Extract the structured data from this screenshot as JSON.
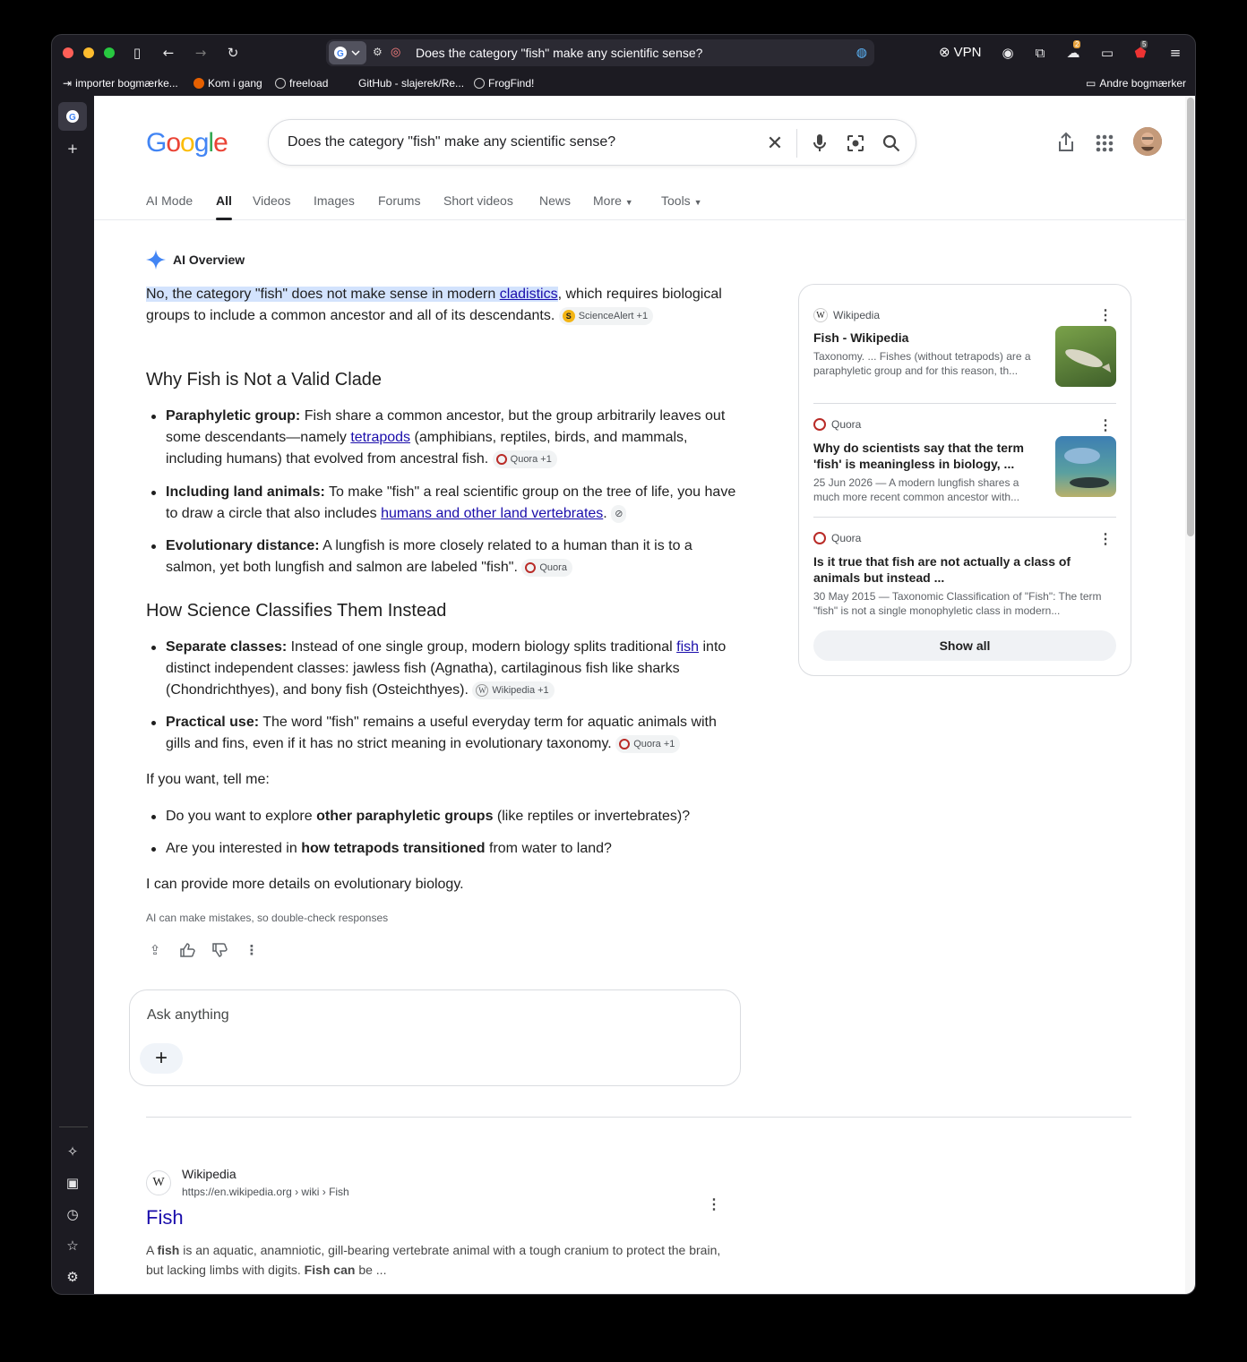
{
  "browser": {
    "url_text": "Does the category \"fish\" make any scientific sense?",
    "vpn_label": "VPN",
    "badge_counts": [
      "2",
      "5"
    ],
    "bookmarks": [
      {
        "label": "importer bogmærke..."
      },
      {
        "label": "Kom i gang"
      },
      {
        "label": "freeload"
      },
      {
        "label": "GitHub - slajerek/Re..."
      },
      {
        "label": "FrogFind!"
      }
    ],
    "other_bookmarks": "Andre bogmærker"
  },
  "google": {
    "logo": "Google",
    "query": "Does the category \"fish\" make any scientific sense?",
    "tabs": [
      "AI Mode",
      "All",
      "Videos",
      "Images",
      "Forums",
      "Short videos",
      "News",
      "More",
      "Tools"
    ]
  },
  "overview": {
    "label": "AI Overview",
    "intro_highlight": "No, the category \"fish\" does not make sense in modern ",
    "intro_link": "cladistics",
    "intro_rest": ", which requires biological groups to include a common ancestor and all of its descendants.",
    "intro_chip": "ScienceAlert +1",
    "h1": "Why Fish is Not a Valid Clade",
    "b1_bold": "Paraphyletic group:",
    "b1_text": " Fish share a common ancestor, but the group arbitrarily leaves out some descendants—namely ",
    "b1_link": "tetrapods",
    "b1_rest": " (amphibians, reptiles, birds, and mammals, including humans) that evolved from ancestral fish.",
    "b1_chip": "Quora +1",
    "b2_bold": "Including land animals:",
    "b2_text": " To make \"fish\" a real scientific group on the tree of life, you have to draw a circle that also includes ",
    "b2_link": "humans and other land vertebrates",
    "b2_rest": ".",
    "b3_bold": "Evolutionary distance:",
    "b3_text": " A lungfish is more closely related to a human than it is to a salmon, yet both lungfish and salmon are labeled \"fish\".",
    "b3_chip": "Quora",
    "h2": "How Science Classifies Them Instead",
    "b4_bold": "Separate classes:",
    "b4_text": " Instead of one single group, modern biology splits traditional ",
    "b4_link": "fish",
    "b4_rest": " into distinct independent classes: jawless fish (Agnatha), cartilaginous fish like sharks (Chondrichthyes), and bony fish (Osteichthyes).",
    "b4_chip": "Wikipedia +1",
    "b5_bold": "Practical use:",
    "b5_text": " The word \"fish\" remains a useful everyday term for aquatic animals with gills and fins, even if it has no strict meaning in evolutionary taxonomy.",
    "b5_chip": "Quora +1",
    "ask_intro": "If you want, tell me:",
    "q1_a": "Do you want to explore ",
    "q1_bold": "other paraphyletic groups",
    "q1_b": " (like reptiles or invertebrates)?",
    "q2_a": "Are you interested in ",
    "q2_bold": "how tetrapods transitioned",
    "q2_b": " from water to land?",
    "closing": "I can provide more details on evolutionary biology.",
    "disclaimer": "AI can make mistakes, so double-check responses",
    "ask_placeholder": "Ask anything"
  },
  "sources": [
    {
      "site": "Wikipedia",
      "title": "Fish - Wikipedia",
      "snippet": "Taxonomy. ... Fishes (without tetrapods) are a paraphyletic group and for this reason, th..."
    },
    {
      "site": "Quora",
      "title": "Why do scientists say that the term 'fish' is meaningless in biology, ...",
      "snippet": "25 Jun 2026 — A modern lungfish shares a much more recent common ancestor with..."
    },
    {
      "site": "Quora",
      "title": "Is it true that fish are not actually a class of animals but instead ...",
      "snippet": "30 May 2015 — Taxonomic Classification of \"Fish\": The term \"fish\" is not a single monophyletic class in modern..."
    }
  ],
  "show_all": "Show all",
  "result": {
    "site": "Wikipedia",
    "url": "https://en.wikipedia.org › wiki › Fish",
    "title": "Fish",
    "snippet_a": "A ",
    "snippet_b1": "fish",
    "snippet_c": " is an aquatic, anamniotic, gill-bearing vertebrate animal with a tough cranium to protect the brain, but lacking limbs with digits. ",
    "snippet_b2": "Fish can",
    "snippet_d": " be ..."
  },
  "colors": {
    "highlight": "#d3e3fd",
    "link": "#1a0dab",
    "accent": "#4285f4"
  }
}
